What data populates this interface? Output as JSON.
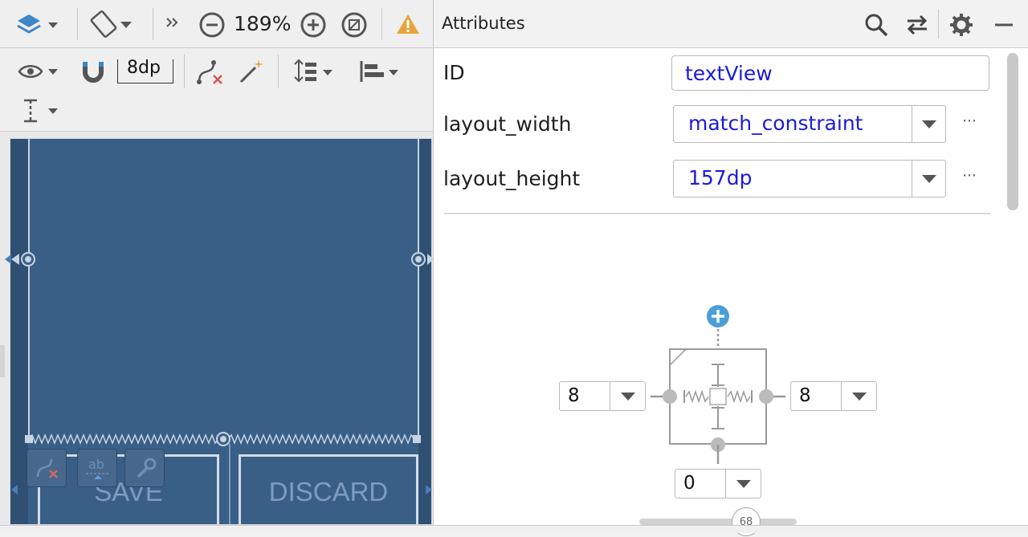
{
  "toolbar": {
    "zoom_level": "189%",
    "margin_value": "8dp",
    "design_surface_icon": "layers-icon",
    "orientation_icon": "rotate-device-icon",
    "overflow_icon": "double-chevron-right-icon",
    "zoom_out_icon": "zoom-out-icon",
    "zoom_in_icon": "zoom-in-icon",
    "zoom_fit_icon": "zoom-to-fit-icon",
    "warning_icon": "warning-icon",
    "view_options_icon": "eye-icon",
    "autoconnect_icon": "magnet-icon",
    "clear_constraints_icon": "clear-constraints-icon",
    "infer_constraints_icon": "magic-wand-icon",
    "pack_icon": "pack-icon",
    "align_icon": "align-icon",
    "guidelines_icon": "guidelines-icon"
  },
  "canvas": {
    "buttons": [
      {
        "label": "SAVE"
      },
      {
        "label": "DISCARD"
      }
    ],
    "background_color": "#3a5f86",
    "line_color": "#c7d4e4"
  },
  "attributes": {
    "title": "Attributes",
    "id_label": "ID",
    "id_value": "textView",
    "layout_width_label": "layout_width",
    "layout_width_value": "match_constraint",
    "layout_height_label": "layout_height",
    "layout_height_value": "157dp",
    "more_label": "⋯",
    "constraint_widget": {
      "left_margin": "8",
      "right_margin": "8",
      "bottom_margin": "0",
      "bias_value": "68"
    },
    "colors": {
      "value_text": "#1a1adb",
      "add_constraint": "#4a9fd8"
    }
  }
}
